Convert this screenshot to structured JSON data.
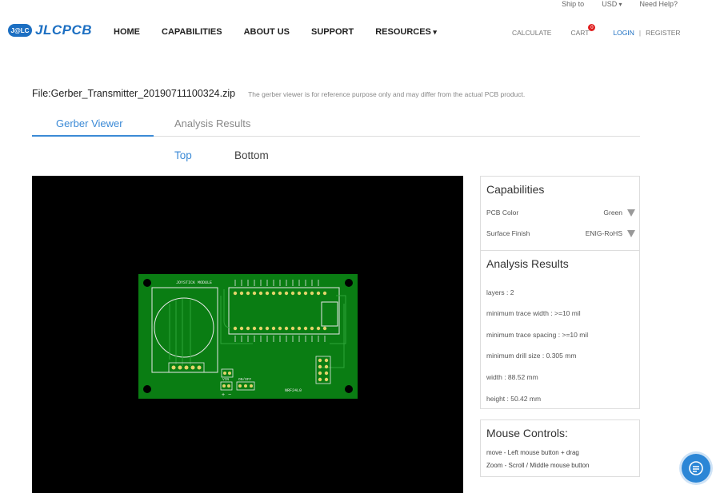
{
  "topbar": {
    "ship_to": "Ship to",
    "currency": "USD",
    "help": "Need Help?"
  },
  "header": {
    "logo_badge": "J@LC",
    "logo_text": "JLCPCB",
    "nav": [
      "HOME",
      "CAPABILITIES",
      "ABOUT US",
      "SUPPORT",
      "RESOURCES"
    ],
    "calculate": "CALCULATE",
    "cart": "CART",
    "cart_count": "0",
    "login": "LOGIN",
    "separator": "|",
    "register": "REGISTER"
  },
  "file": {
    "name": "File:Gerber_Transmitter_20190711100324.zip",
    "note": "The gerber viewer is for reference purpose only and may differ from the actual PCB product."
  },
  "tabs": {
    "gerber": "Gerber Viewer",
    "analysis": "Analysis Results"
  },
  "layers": {
    "top": "Top",
    "bottom": "Bottom"
  },
  "pcb": {
    "board_color": "#0a7d13",
    "label_joystick": "JOYSTICK MODULE",
    "label_nrf": "NRF24L0",
    "label_vin": "VIN",
    "label_onoff": "ON/OFF",
    "label_plus": "+",
    "label_minus": "−"
  },
  "capabilities": {
    "title": "Capabilities",
    "pcb_color_label": "PCB Color",
    "pcb_color_value": "Green",
    "surface_label": "Surface Finish",
    "surface_value": "ENIG-RoHS"
  },
  "analysis": {
    "title": "Analysis Results",
    "layers": "layers : 2",
    "min_trace_width": "minimum trace width : >=10 mil",
    "min_trace_spacing": "minimum trace spacing : >=10 mil",
    "min_drill": "minimum drill size : 0.305 mm",
    "width": "width : 88.52 mm",
    "height": "height : 50.42 mm"
  },
  "mouse": {
    "title": "Mouse Controls:",
    "move": "move - Left mouse button + drag",
    "zoom": "Zoom - Scroll / Middle mouse button"
  },
  "colors": {
    "accent": "#3b8ad6",
    "brand": "#1c6fc2",
    "cart_badge": "#e02020",
    "viewer_bg": "#000000"
  }
}
